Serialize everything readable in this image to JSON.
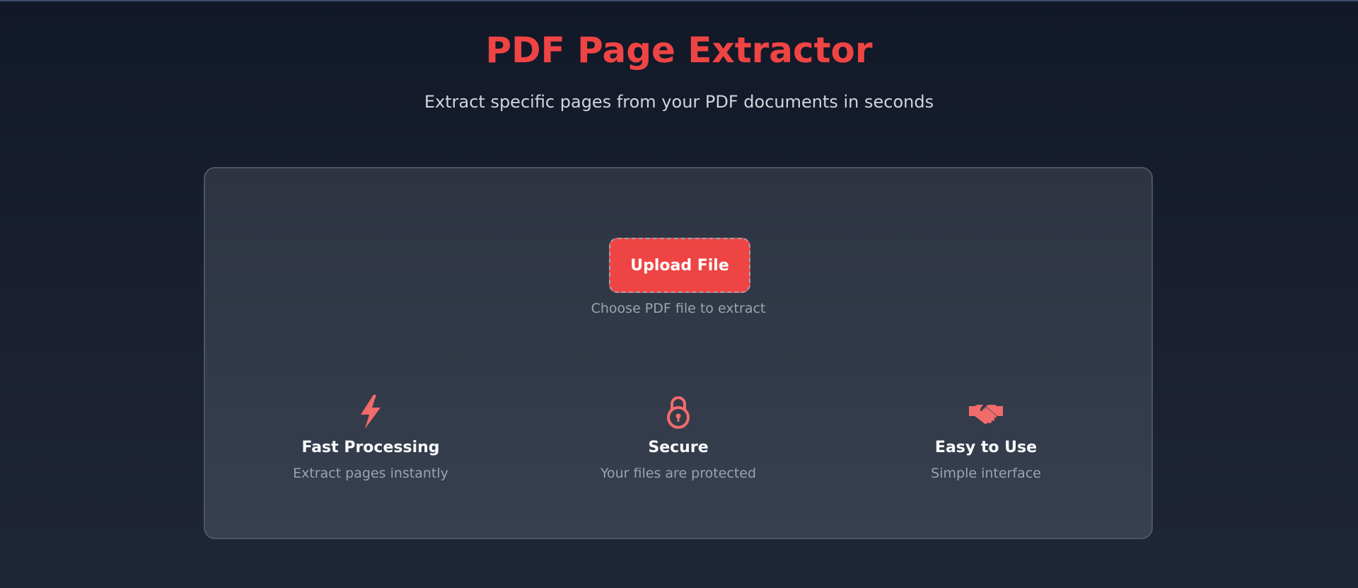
{
  "header": {
    "title": "PDF Page Extractor",
    "subtitle": "Extract specific pages from your PDF documents in seconds"
  },
  "upload": {
    "button_label": "Upload File",
    "hint": "Choose PDF file to extract"
  },
  "features": [
    {
      "icon": "lightning-bolt-icon",
      "title": "Fast Processing",
      "description": "Extract pages instantly"
    },
    {
      "icon": "padlock-icon",
      "title": "Secure",
      "description": "Your files are protected"
    },
    {
      "icon": "handshake-icon",
      "title": "Easy to Use",
      "description": "Simple interface"
    }
  ],
  "colors": {
    "accent": "#ef4444",
    "icon": "#f26b6b",
    "background": "#111827",
    "card": "#2d3341",
    "muted_text": "#9ca3af"
  }
}
